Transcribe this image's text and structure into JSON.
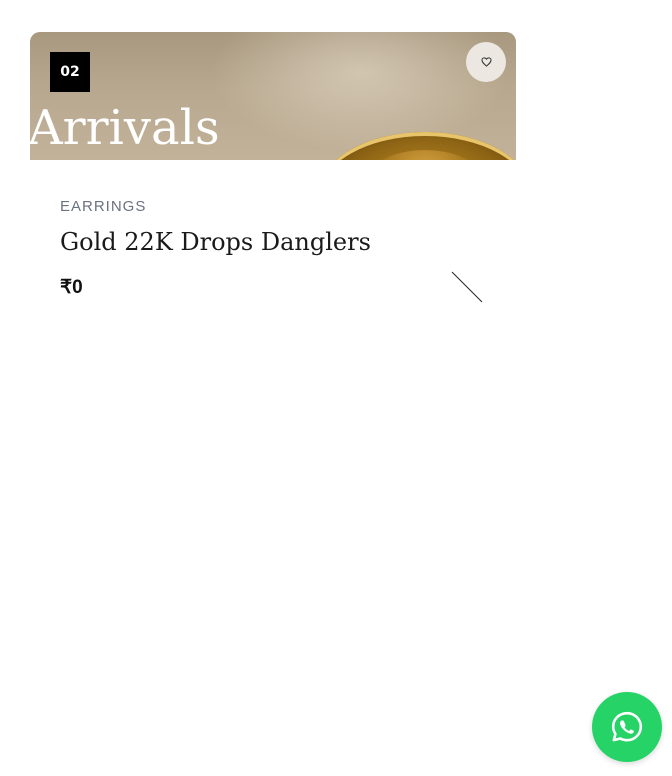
{
  "product_card": {
    "badge": "02",
    "overlay_text": "Arrivals",
    "wishlist_icon": "heart-icon",
    "category": "EARRINGS",
    "name": "Gold 22K Drops Danglers",
    "price": "₹0"
  },
  "floating": {
    "whatsapp_icon": "whatsapp-icon"
  },
  "colors": {
    "whatsapp": "#25d366",
    "badge_bg": "#000000",
    "category_text": "#6b7280"
  }
}
